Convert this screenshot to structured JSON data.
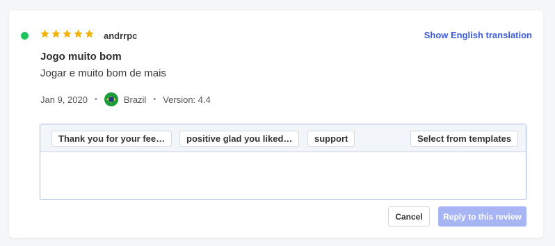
{
  "review": {
    "status_color": "#1fc45f",
    "rating": 5,
    "rating_max": 5,
    "author": "andrrpc",
    "translate_label": "Show English translation",
    "title": "Jogo muito bom",
    "body": "Jogar e muito bom de mais",
    "date": "Jan 9, 2020",
    "country": "Brazil",
    "flag_icon": "brazil-flag-icon",
    "version": "Version: 4.4",
    "meta_separator": "•"
  },
  "reply": {
    "templates": [
      {
        "label": "Thank you for your fee…"
      },
      {
        "label": "positive glad you liked…"
      },
      {
        "label": "support"
      }
    ],
    "select_templates_label": "Select from templates",
    "textarea_value": "",
    "cancel_label": "Cancel",
    "submit_label": "Reply to this review"
  },
  "colors": {
    "accent": "#3c5bd6",
    "star": "#f5b301",
    "submit_disabled": "#a7b5f5"
  }
}
